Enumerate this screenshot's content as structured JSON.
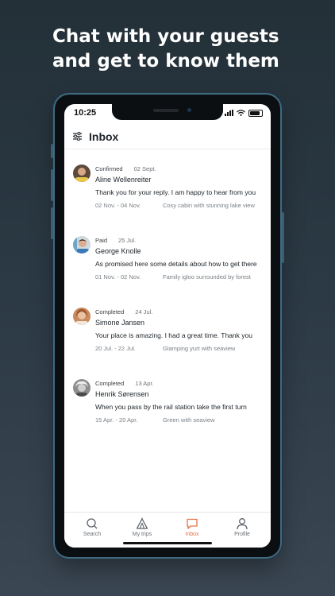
{
  "promo": {
    "line1": "Chat with your guests",
    "line2": "and get to know them"
  },
  "status_bar": {
    "time": "10:25"
  },
  "header": {
    "title": "Inbox",
    "icon": "filter-icon"
  },
  "conversations": [
    {
      "status": "Confirmed",
      "date": "02 Sept.",
      "name": "Aline Wellenreiter",
      "message": "Thank you for your reply. I am happy to hear from you",
      "range": "02 Nov. - 04 Nov.",
      "listing": "Cosy cabin with stunning lake view"
    },
    {
      "status": "Paid",
      "date": "25 Jul.",
      "name": "George Knolle",
      "message": "As promised here some details about how to get there",
      "range": "01 Nov. - 02 Nov.",
      "listing": "Family igloo surrounded by forest"
    },
    {
      "status": "Completed",
      "date": "24 Jul.",
      "name": "Simone Jansen",
      "message": "Your place is amazing. I had a great time. Thank you",
      "range": "20 Jul. - 22 Jul.",
      "listing": "Glamping yurt with seaview"
    },
    {
      "status": "Completed",
      "date": "13 Apr.",
      "name": "Henrik Sørensen",
      "message": "When you pass by the rail station take the first turn",
      "range": "15 Apr. - 20 Apr.",
      "listing": "Green with seaview"
    }
  ],
  "tabs": [
    {
      "label": "Search",
      "icon": "search-icon",
      "active": false
    },
    {
      "label": "My trips",
      "icon": "tent-icon",
      "active": false
    },
    {
      "label": "Inbox",
      "icon": "chat-icon",
      "active": true
    },
    {
      "label": "Profile",
      "icon": "profile-icon",
      "active": false
    }
  ],
  "colors": {
    "accent": "#e2734a",
    "background_top": "#233038",
    "background_bottom": "#3a4652",
    "phone_frame": "#3f6a80"
  }
}
